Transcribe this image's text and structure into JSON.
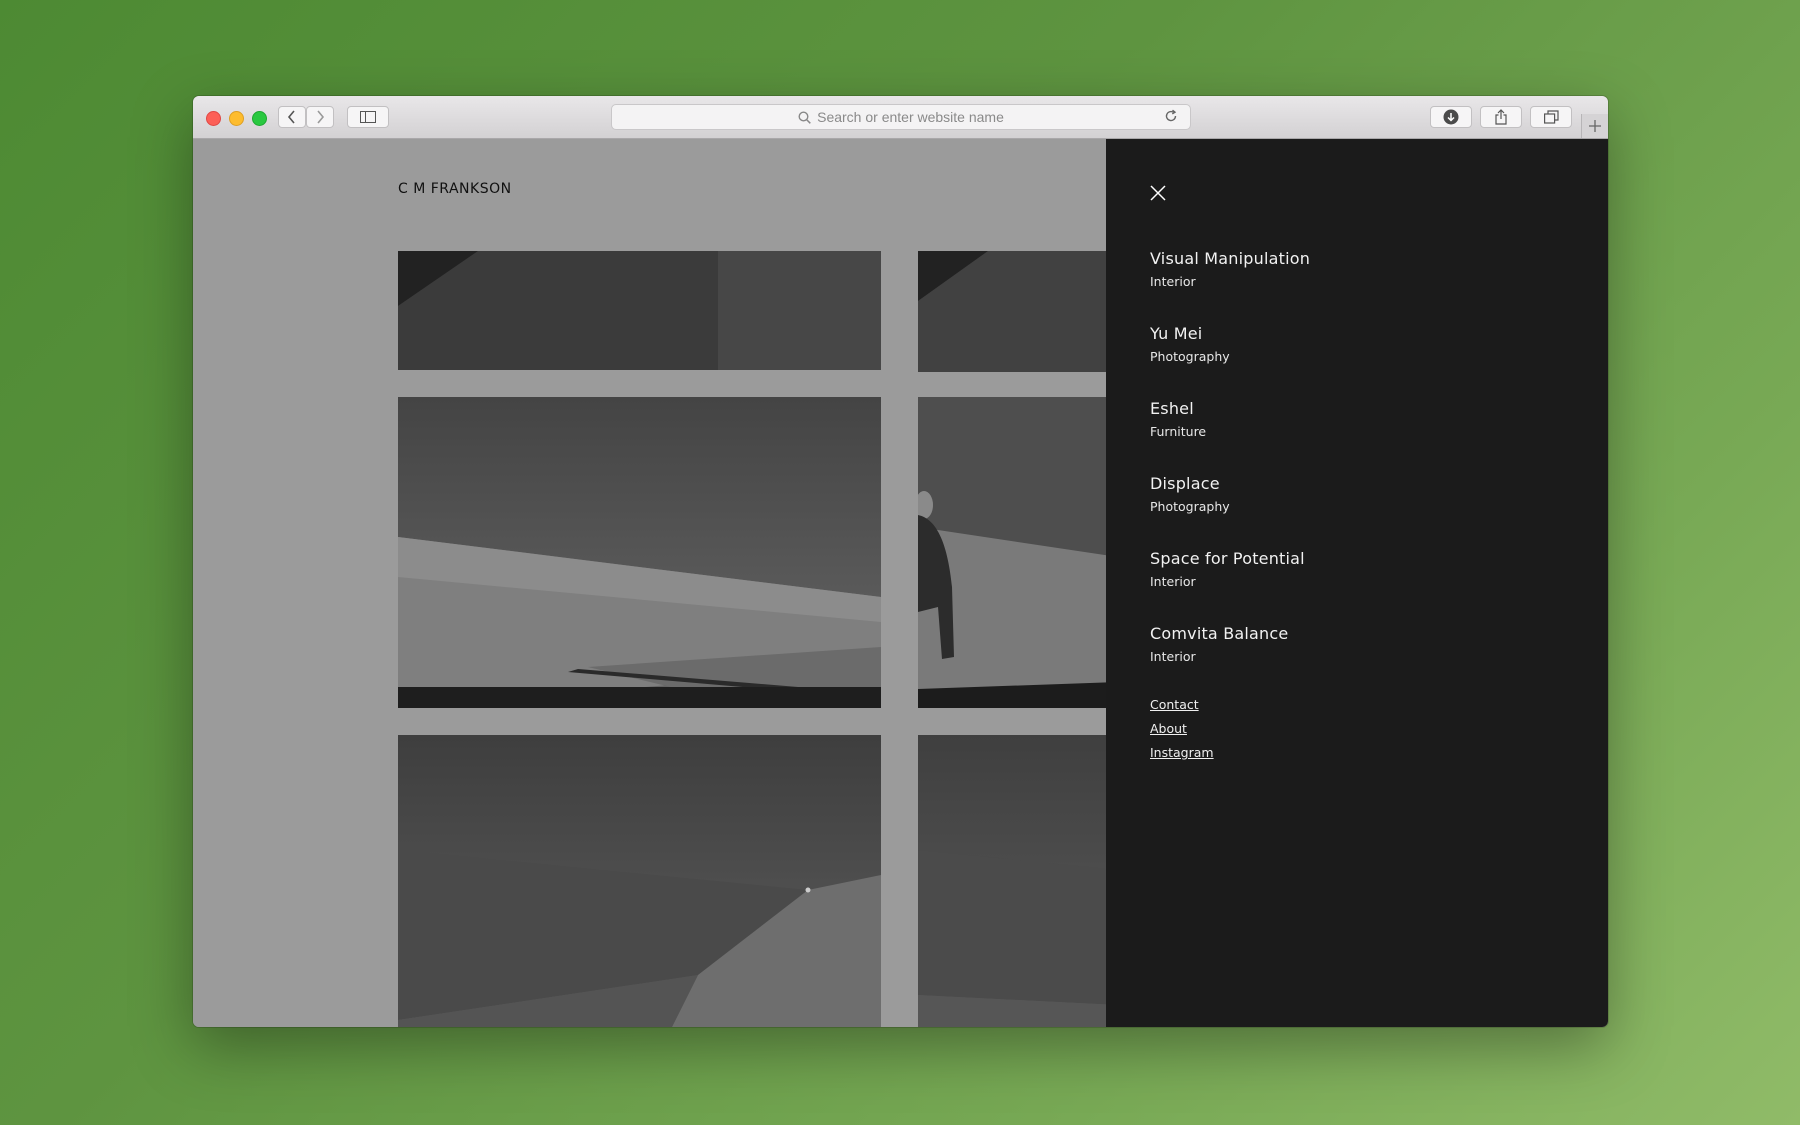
{
  "browser": {
    "url_placeholder": "Search or enter website name"
  },
  "site": {
    "title": "C M FRANKSON"
  },
  "menu": {
    "projects": [
      {
        "name": "Visual Manipulation",
        "category": "Interior"
      },
      {
        "name": "Yu Mei",
        "category": "Photography"
      },
      {
        "name": "Eshel",
        "category": "Furniture"
      },
      {
        "name": "Displace",
        "category": "Photography"
      },
      {
        "name": "Space for Potential",
        "category": "Interior"
      },
      {
        "name": "Comvita Balance",
        "category": "Interior"
      }
    ],
    "links": [
      "Contact",
      "About",
      "Instagram"
    ]
  },
  "colors": {
    "desktop": "#5e9440",
    "page_bg": "#9b9b9b",
    "menu_bg": "#1b1b1b"
  }
}
